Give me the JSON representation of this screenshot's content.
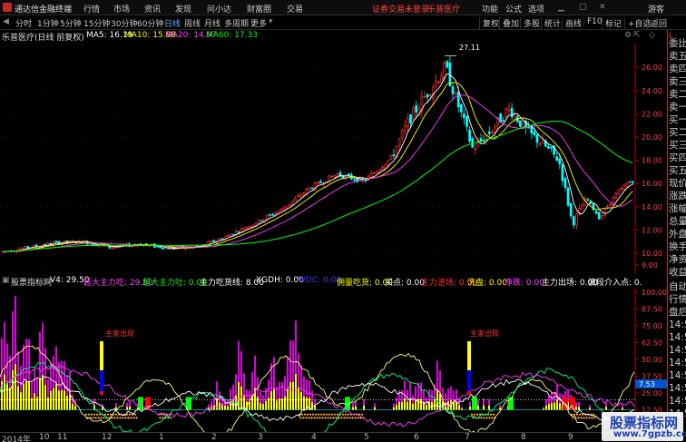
{
  "menubar": {
    "app_title": "通达信金融终端",
    "menus": [
      "行情",
      "市场",
      "资讯",
      "发现",
      "问小达",
      "财富圈",
      "交易"
    ],
    "notice": "证券交易未登录",
    "stock_name": "乐普医疗",
    "right_menus": [
      "功能",
      "公式",
      "选项"
    ],
    "guest": "游客",
    "colors": {
      "notice": "#ff4040",
      "bar": "#0d0d0d"
    }
  },
  "toolbar": {
    "periods": [
      "分时",
      "1分钟",
      "5分钟",
      "15分钟",
      "30分钟",
      "60分钟",
      "日线",
      "周线",
      "月线",
      "多周期",
      "更多"
    ],
    "active_period": "日线",
    "right_tools": [
      "复权",
      "叠加",
      "多股",
      "统计",
      "画线",
      "F10",
      "标记",
      "+自选",
      "返回"
    ]
  },
  "kline": {
    "title": "乐普医疗(日线 前复权)",
    "ma": [
      {
        "label": "MA5: 16.19",
        "color": "#ffffff"
      },
      {
        "label": "MA10: 15.88",
        "color": "#ffff00"
      },
      {
        "label": "MA20: 14.97",
        "color": "#ff40ff"
      },
      {
        "label": "MA60: 17.33",
        "color": "#00ff00"
      }
    ],
    "y_ticks": [
      "26.00",
      "24.00",
      "22.00",
      "20.00",
      "18.00",
      "16.00",
      "14.00",
      "12.00",
      "10.00",
      "9.00"
    ],
    "max_label": "27.11",
    "colors": {
      "up": "#ff3232",
      "down": "#00ffff",
      "ma5": "#ffffff",
      "ma10": "#ffff00",
      "ma20": "#ff40ff",
      "ma60": "#00ff00"
    }
  },
  "indicator": {
    "name": "股票指标网",
    "items": [
      {
        "label": "V4: 29.50",
        "color": "#ffffff"
      },
      {
        "label": "超大主力吃: 29.50",
        "color": "#ff40ff"
      },
      {
        "label": "超大主力吐: 0.00",
        "color": "#00ff00"
      },
      {
        "label": "主力吃货线: 8.00",
        "color": "#ffffff"
      },
      {
        "label": "XGDH: 0.00",
        "color": "#ffffff"
      },
      {
        "label": "WDC: 0.00",
        "color": "#3a3aff"
      },
      {
        "label": "佣量吃货: 0.00",
        "color": "#ffff00"
      },
      {
        "label": "买点: 0.00",
        "color": "#ffffff"
      },
      {
        "label": "主力进场: 0.00",
        "color": "#ff3232"
      },
      {
        "label": "洗盘: 0.00",
        "color": "#ffff00"
      },
      {
        "label": "净跌: 0.00",
        "color": "#ff40ff"
      },
      {
        "label": "主力出场: 0.00",
        "color": "#ffffff"
      },
      {
        "label": "波段介入点: 0.",
        "color": "#ffffff"
      }
    ],
    "y_ticks": [
      "100.00",
      "87.50",
      "75.00",
      "62.50",
      "50.00",
      "37.50",
      "25.00",
      "12.50",
      "0.00"
    ],
    "current_value": "7.53",
    "annotations": [
      "主家出现",
      "主家出现"
    ]
  },
  "right_panel": {
    "labels": [
      "委比",
      "卖五",
      "卖四",
      "卖三",
      "卖二",
      "卖一",
      "买一",
      "买二",
      "买三",
      "买四",
      "买五",
      "现价",
      "涨跌",
      "涨幅",
      "总量",
      "外盘",
      "换手",
      "净资",
      "收益",
      "自动",
      "行情",
      "盘后",
      "14:5",
      "14:5",
      "14:5",
      "14:5",
      "14:5",
      "14:5",
      "14:5",
      "14:5"
    ],
    "header": "L"
  },
  "time_axis": {
    "labels": [
      "2014年",
      "10",
      "11",
      "12",
      "1",
      "2",
      "3",
      "4",
      "5",
      "6",
      "7",
      "8",
      "9"
    ]
  },
  "watermark": {
    "title": "股票指标网",
    "url": "www.7gpzb.com"
  }
}
